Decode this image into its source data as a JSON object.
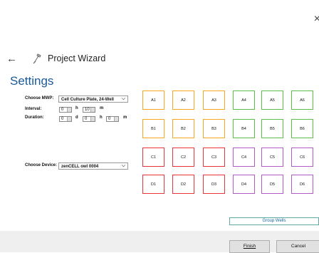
{
  "window": {
    "close_symbol": "×"
  },
  "header": {
    "back_symbol": "←",
    "title": "Project Wizard"
  },
  "page": {
    "title": "Settings"
  },
  "form": {
    "mwp_label": "Choose MWP:",
    "mwp_value": "Cell Culture Plate, 24-Well",
    "interval_label": "Interval:",
    "interval_h": "0",
    "interval_h_unit": "h",
    "interval_m": "10",
    "interval_m_unit": "m",
    "duration_label": "Duration:",
    "duration_d": "0",
    "duration_d_unit": "d",
    "duration_h": "0",
    "duration_h_unit": "h",
    "duration_m": "0",
    "duration_m_unit": "m",
    "device_label": "Choose Device:",
    "device_value": "zenCELL owl 0004"
  },
  "wells": {
    "rows": [
      [
        {
          "label": "A1",
          "color": "#f5a623"
        },
        {
          "label": "A2",
          "color": "#f5a623"
        },
        {
          "label": "A3",
          "color": "#f5a623"
        },
        {
          "label": "A4",
          "color": "#5cbf4a"
        },
        {
          "label": "A5",
          "color": "#5cbf4a"
        },
        {
          "label": "A6",
          "color": "#5cbf4a"
        }
      ],
      [
        {
          "label": "B1",
          "color": "#f5a623"
        },
        {
          "label": "B2",
          "color": "#f5a623"
        },
        {
          "label": "B3",
          "color": "#f5a623"
        },
        {
          "label": "B4",
          "color": "#5cbf4a"
        },
        {
          "label": "B5",
          "color": "#5cbf4a"
        },
        {
          "label": "B6",
          "color": "#5cbf4a"
        }
      ],
      [
        {
          "label": "C1",
          "color": "#e8343a"
        },
        {
          "label": "C2",
          "color": "#e8343a"
        },
        {
          "label": "C3",
          "color": "#e8343a"
        },
        {
          "label": "C4",
          "color": "#b35cc7"
        },
        {
          "label": "C5",
          "color": "#b35cc7"
        },
        {
          "label": "C6",
          "color": "#b35cc7"
        }
      ],
      [
        {
          "label": "D1",
          "color": "#e8343a"
        },
        {
          "label": "D2",
          "color": "#e8343a"
        },
        {
          "label": "D3",
          "color": "#e8343a"
        },
        {
          "label": "D4",
          "color": "#b35cc7"
        },
        {
          "label": "D5",
          "color": "#b35cc7"
        },
        {
          "label": "D6",
          "color": "#b35cc7"
        }
      ]
    ]
  },
  "buttons": {
    "group_wells": "Group Wells",
    "finish": "Finish",
    "cancel": "Cancel"
  }
}
